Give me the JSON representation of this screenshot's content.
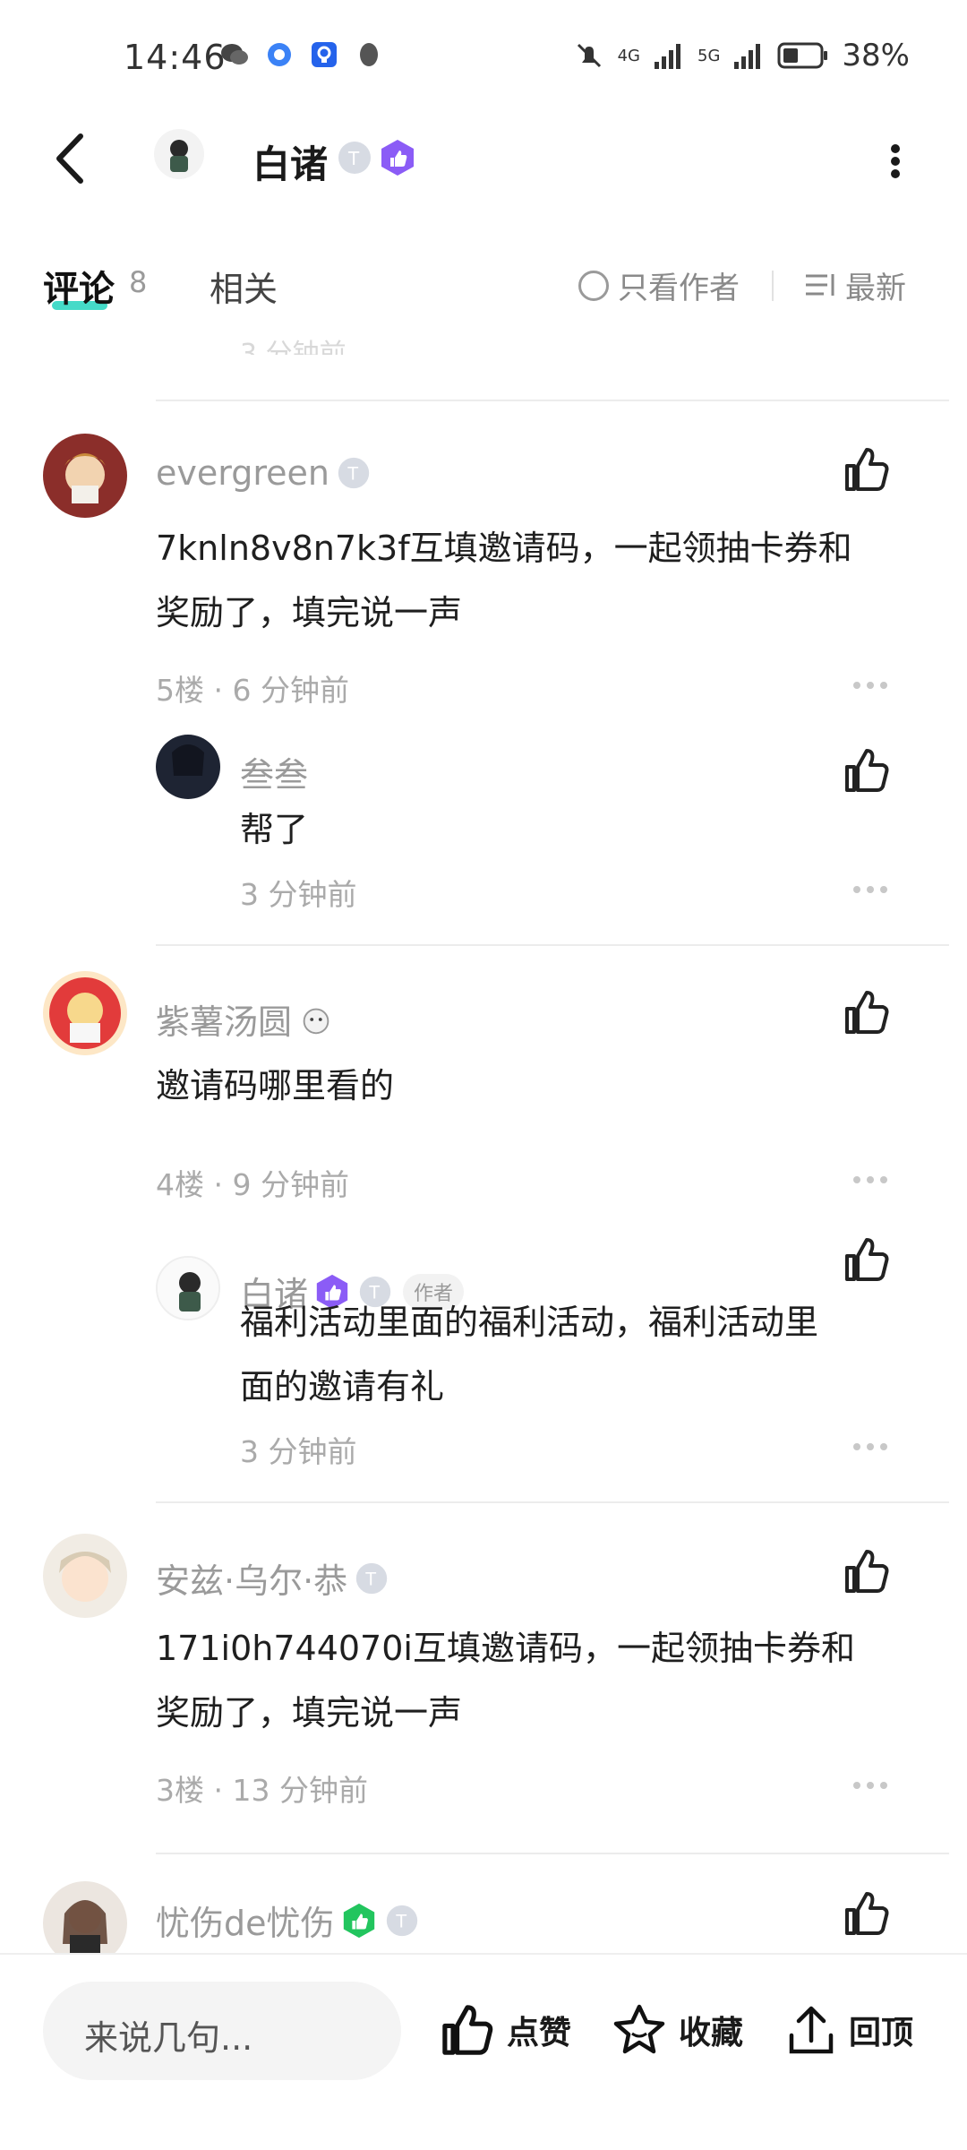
{
  "status_bar": {
    "time": "14:46",
    "battery": "38%",
    "net1": "4G",
    "net2": "5G"
  },
  "header": {
    "title": "白诸"
  },
  "tabs": {
    "comments_label": "评论",
    "comments_count": "8",
    "related_label": "相关",
    "author_only_label": "只看作者",
    "sort_label": "最新"
  },
  "ghost_meta": "3 分钟前",
  "comments": [
    {
      "user": "evergreen",
      "text_line1": "7knln8v8n7k3f互填邀请码，一起领抽卡券和",
      "text_line2": "奖励了，填完说一声",
      "meta": "5楼 · 6 分钟前",
      "reply": {
        "user": "叁叁",
        "text": "帮了",
        "meta": "3 分钟前"
      }
    },
    {
      "user": "紫薯汤圆",
      "text_line1": "邀请码哪里看的",
      "meta": "4楼 · 9 分钟前",
      "reply": {
        "user": "白诸",
        "tag": "作者",
        "text_line1": "福利活动里面的福利活动，福利活动里",
        "text_line2": "面的邀请有礼",
        "meta": "3 分钟前"
      }
    },
    {
      "user": "安兹·乌尔·恭",
      "text_line1": "171i0h744070i互填邀请码，一起领抽卡券和",
      "text_line2": "奖励了，填完说一声",
      "meta": "3楼 · 13 分钟前"
    },
    {
      "user": "忧伤de忧伤"
    }
  ],
  "bottom_bar": {
    "input_placeholder": "来说几句...",
    "like_label": "点赞",
    "fav_label": "收藏",
    "top_label": "回顶"
  },
  "colors": {
    "accent": "#31d6c2",
    "purple_badge": "#8b5cf6",
    "green_badge": "#22c55e"
  }
}
